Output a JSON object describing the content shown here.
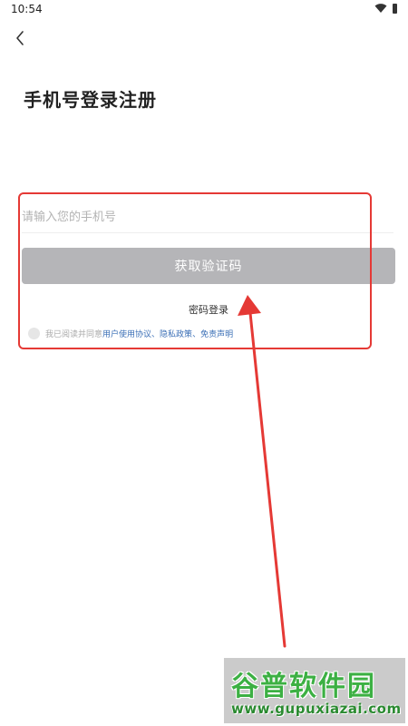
{
  "status_bar": {
    "time": "10:54",
    "icons": [
      "wifi-icon",
      "battery-icon"
    ]
  },
  "header": {
    "back_icon": "chevron-left-icon",
    "title": "手机号登录注册"
  },
  "form": {
    "phone_placeholder": "请输入您的手机号",
    "phone_value": "",
    "get_code_label": "获取验证码",
    "password_login_label": "密码登录",
    "agreement": {
      "prefix": "我已阅读并同意",
      "user_agreement": "用户使用协议",
      "sep1": "、",
      "privacy_policy": "隐私政策",
      "sep2": "、",
      "disclaimer": "免责声明"
    }
  },
  "watermark": {
    "title": "谷普软件园",
    "url": "www.gupuxiazai.com"
  },
  "colors": {
    "button_disabled": "#b5b5b8",
    "link": "#3b6fb6",
    "annotation": "#e53935",
    "watermark_green": "#3cb043"
  }
}
